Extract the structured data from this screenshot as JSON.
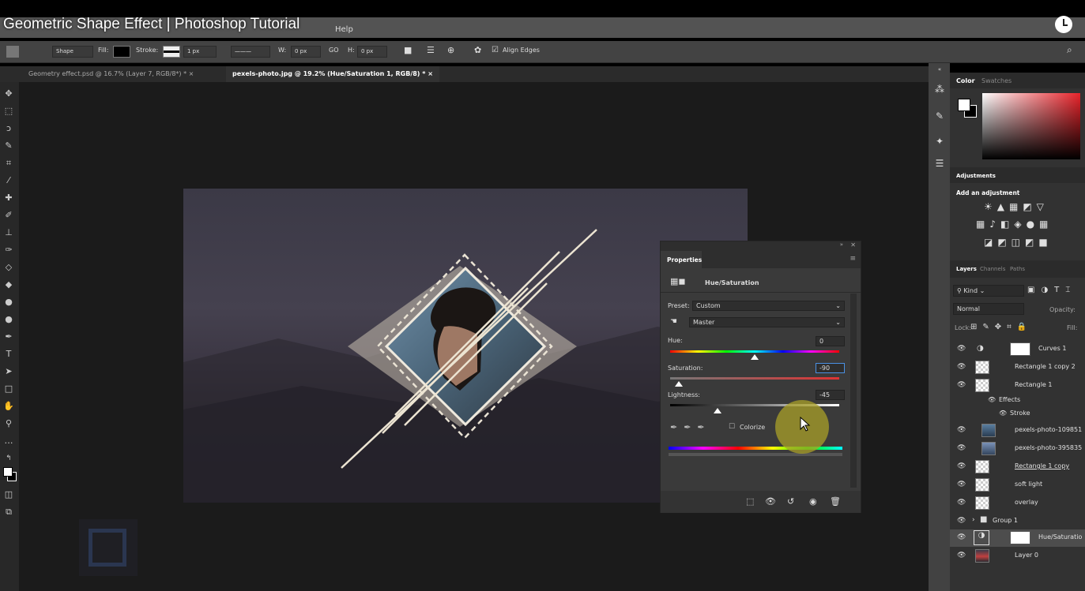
{
  "video": {
    "title": "Geometric Shape Effect | Photoshop Tutorial"
  },
  "menubar": {
    "help": "Help"
  },
  "options": {
    "shape_mode": "Shape",
    "fill_label": "Fill:",
    "stroke_label": "Stroke:",
    "stroke_width": "1 px",
    "w_label": "W:",
    "w_value": "0 px",
    "link": "GO",
    "h_label": "H:",
    "h_value": "0 px",
    "align_edges": "Align Edges"
  },
  "tabs": [
    {
      "label": "Geometry effect.psd @ 16.7% (Layer 7, RGB/8*) *",
      "close": "×"
    },
    {
      "label": "pexels-photo.jpg @ 19.2% (Hue/Saturation 1, RGB/8) *",
      "close": "×"
    }
  ],
  "color_panel": {
    "tab_color": "Color",
    "tab_swatches": "Swatches",
    "fg": "#ffffff",
    "bg": "#000000",
    "hue": "#e8232a"
  },
  "adjustments": {
    "tab": "Adjustments",
    "add_label": "Add an adjustment"
  },
  "layers_panel": {
    "tabs": [
      "Layers",
      "Channels",
      "Paths"
    ],
    "filter": "Kind",
    "blend_mode": "Normal",
    "opacity_label": "Opacity:",
    "lock_label": "Lock:",
    "fill_label": "Fill:",
    "layers": [
      {
        "name": "Curves 1"
      },
      {
        "name": "Rectangle 1 copy 2"
      },
      {
        "name": "Rectangle 1"
      },
      {
        "name": "Effects"
      },
      {
        "name": "Stroke"
      },
      {
        "name": "pexels-photo-109851"
      },
      {
        "name": "pexels-photo-395835"
      },
      {
        "name": "Rectangle 1 copy"
      },
      {
        "name": "soft light"
      },
      {
        "name": "overlay"
      },
      {
        "name": "Group 1"
      },
      {
        "name": "Hue/Saturatio"
      },
      {
        "name": "Layer 0"
      }
    ]
  },
  "properties": {
    "title": "Properties",
    "type": "Hue/Saturation",
    "preset_label": "Preset:",
    "preset_value": "Custom",
    "channel": "Master",
    "hue_label": "Hue:",
    "hue_value": "0",
    "sat_label": "Saturation:",
    "sat_value": "-90",
    "light_label": "Lightness:",
    "light_value": "-45",
    "colorize": "Colorize",
    "hue_level": 0.5,
    "sat_level": 0.05,
    "light_level": 0.28
  }
}
